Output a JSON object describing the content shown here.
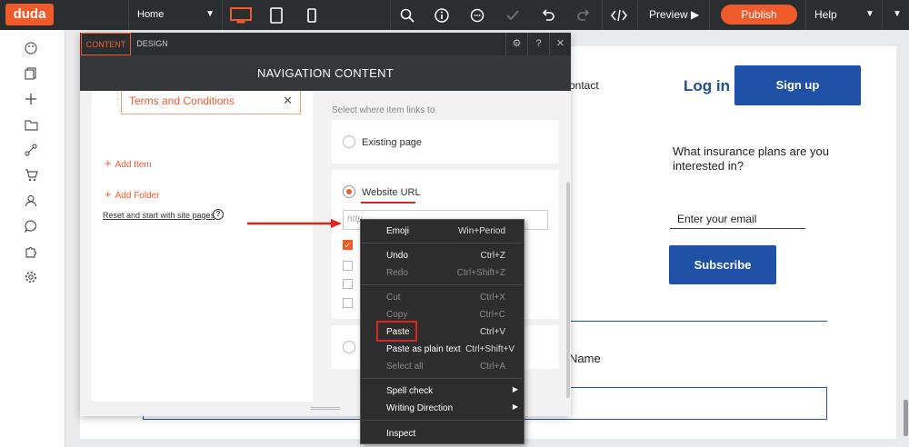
{
  "topbar": {
    "logo": "duda",
    "page": "Home",
    "preview": "Preview",
    "publish": "Publish",
    "help": "Help"
  },
  "panel": {
    "tab_content": "CONTENT",
    "tab_design": "DESIGN",
    "title": "NAVIGATION CONTENT",
    "nav_item": "Terms and Conditions",
    "add_item": "Add Item",
    "add_folder": "Add Folder",
    "reset": "Reset and start with site pages",
    "select_label": "Select where item links to",
    "existing_page": "Existing page",
    "website_url": "Website URL",
    "url_placeholder": "http..."
  },
  "site": {
    "contact": "ontact",
    "login": "Log in",
    "signup": "Sign up",
    "question": "What insurance plans are you interested in?",
    "email_placeholder": "Enter your email",
    "subscribe": "Subscribe",
    "name_label": "Name"
  },
  "context_menu": [
    {
      "label": "Emoji",
      "shortcut": "Win+Period",
      "disabled": false
    },
    {
      "label": "Undo",
      "shortcut": "Ctrl+Z",
      "disabled": false
    },
    {
      "label": "Redo",
      "shortcut": "Ctrl+Shift+Z",
      "disabled": true
    },
    {
      "label": "Cut",
      "shortcut": "Ctrl+X",
      "disabled": true
    },
    {
      "label": "Copy",
      "shortcut": "Ctrl+C",
      "disabled": true
    },
    {
      "label": "Paste",
      "shortcut": "Ctrl+V",
      "disabled": false
    },
    {
      "label": "Paste as plain text",
      "shortcut": "Ctrl+Shift+V",
      "disabled": false
    },
    {
      "label": "Select all",
      "shortcut": "Ctrl+A",
      "disabled": true
    },
    {
      "label": "Spell check",
      "shortcut": "",
      "disabled": false
    },
    {
      "label": "Writing Direction",
      "shortcut": "",
      "disabled": false
    },
    {
      "label": "Inspect",
      "shortcut": "",
      "disabled": false
    }
  ],
  "colors": {
    "brand": "#f15a2b",
    "site_blue": "#1f52a6",
    "highlight_red": "#e0231f"
  }
}
